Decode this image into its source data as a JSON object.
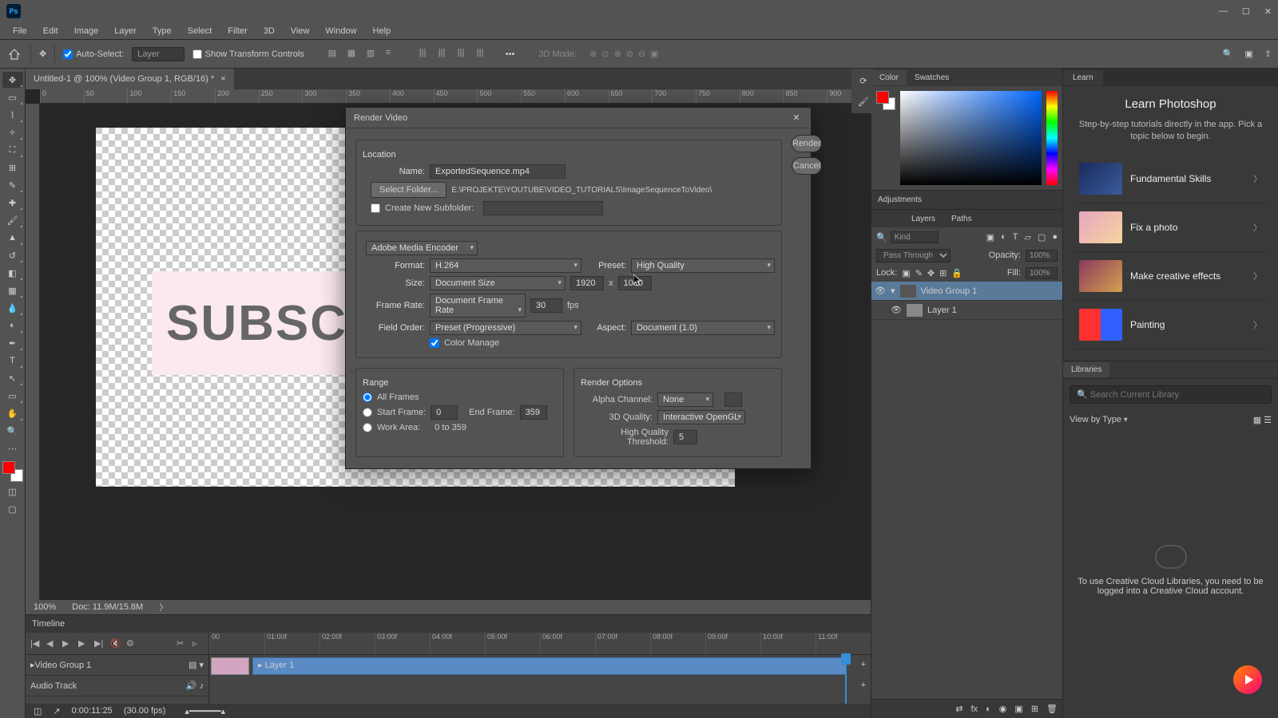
{
  "app": {
    "logo": "Ps"
  },
  "window_controls": {
    "min": "—",
    "max": "☐",
    "close": "✕"
  },
  "menu": [
    "File",
    "Edit",
    "Image",
    "Layer",
    "Type",
    "Select",
    "Filter",
    "3D",
    "View",
    "Window",
    "Help"
  ],
  "options": {
    "auto_select": "Auto-Select:",
    "layer": "Layer",
    "show_transform": "Show Transform Controls",
    "threeDmode": "3D Mode:"
  },
  "document": {
    "tab": "Untitled-1 @ 100% (Video Group 1, RGB/16) *",
    "close": "×",
    "ruler_h": [
      "0",
      "50",
      "100",
      "150",
      "200",
      "250",
      "300",
      "350",
      "400",
      "450",
      "500",
      "550",
      "600",
      "650",
      "700",
      "750",
      "800",
      "850",
      "900"
    ],
    "art_text": "SUBSC"
  },
  "status": {
    "zoom": "100%",
    "doc": "Doc: 11.9M/15.8M"
  },
  "timeline": {
    "title": "Timeline",
    "group": "Video Group 1",
    "layer": "Layer 1",
    "audio": "Audio Track",
    "ruler": [
      "00",
      "01:00f",
      "02:00f",
      "03:00f",
      "04:00f",
      "05:00f",
      "06:00f",
      "07:00f",
      "08:00f",
      "09:00f",
      "10:00f",
      "11:00f"
    ],
    "time": "0:00:11:25",
    "fps": "(30.00 fps)"
  },
  "panels": {
    "color": "Color",
    "swatches": "Swatches",
    "adjustments": "Adjustments",
    "layers": "Layers",
    "paths": "Paths",
    "kind": "Kind",
    "passthrough": "Pass Through",
    "opacity_lbl": "Opacity:",
    "opacity": "100%",
    "lock_lbl": "Lock:",
    "fill_lbl": "Fill:",
    "fill": "100%",
    "layer_group": "Video Group 1",
    "layer_1": "Layer 1"
  },
  "learn": {
    "tab": "Learn",
    "title": "Learn Photoshop",
    "sub": "Step-by-step tutorials directly in the app. Pick a topic below to begin.",
    "items": [
      "Fundamental Skills",
      "Fix a photo",
      "Make creative effects",
      "Painting"
    ],
    "libraries": "Libraries",
    "search_ph": "Search Current Library",
    "view": "View by Type",
    "cc_msg": "To use Creative Cloud Libraries, you need to be logged into a Creative Cloud account."
  },
  "dialog": {
    "title": "Render Video",
    "render": "Render",
    "cancel": "Cancel",
    "location": "Location",
    "name_lbl": "Name:",
    "name": "ExportedSequence.mp4",
    "select_folder": "Select Folder...",
    "folder_path": "E:\\PROJEKTE\\YOUTUBE\\VIDEO_TUTORIALS\\ImageSequenceToVideo\\",
    "create_sub": "Create New Subfolder:",
    "encoder": "Adobe Media Encoder",
    "format_lbl": "Format:",
    "format": "H.264",
    "preset_lbl": "Preset:",
    "preset": "High Quality",
    "size_lbl": "Size:",
    "size": "Document Size",
    "w": "1920",
    "x": "x",
    "h": "1080",
    "fr_lbl": "Frame Rate:",
    "fr": "Document Frame Rate",
    "fr_val": "30",
    "fps": "fps",
    "fo_lbl": "Field Order:",
    "fo": "Preset (Progressive)",
    "aspect_lbl": "Aspect:",
    "aspect": "Document (1.0)",
    "color_manage": "Color Manage",
    "range": "Range",
    "all_frames": "All Frames",
    "start_frame": "Start Frame:",
    "sf": "0",
    "end_frame": "End Frame:",
    "ef": "359",
    "work_area": "Work Area:",
    "wa": "0 to 359",
    "render_options": "Render Options",
    "alpha_lbl": "Alpha Channel:",
    "alpha": "None",
    "q3d_lbl": "3D Quality:",
    "q3d": "Interactive OpenGL",
    "hqt_lbl": "High Quality Threshold:",
    "hqt": "5"
  }
}
